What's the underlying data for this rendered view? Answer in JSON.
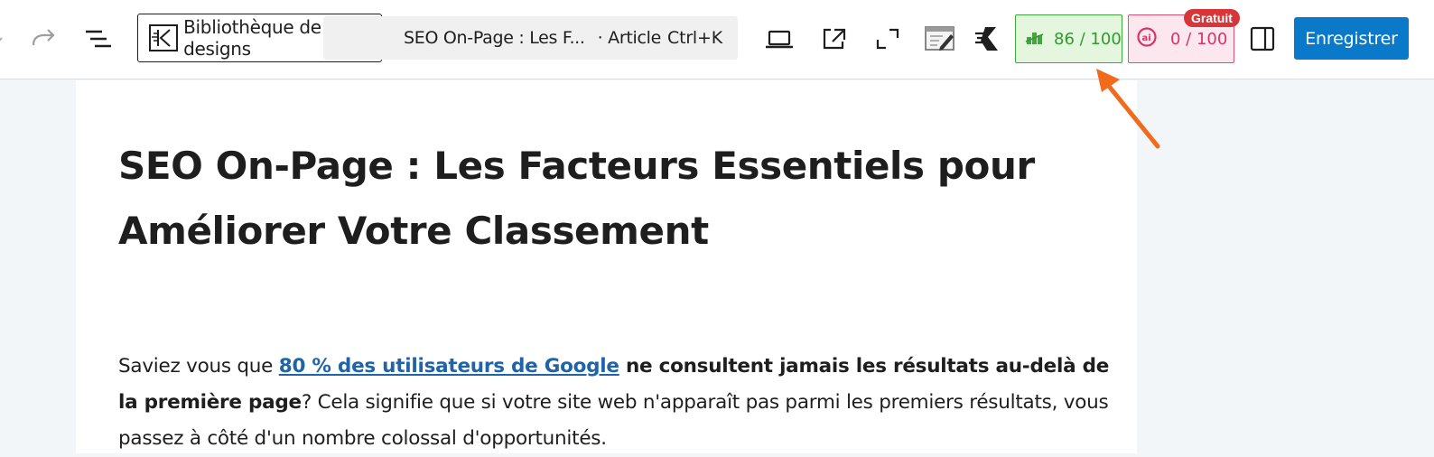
{
  "toolbar": {
    "design_library_label": "Bibliothèque de designs",
    "document": {
      "title": "SEO On-Page : Les F...",
      "type": "· Article",
      "shortcut": "Ctrl+K"
    },
    "seo_score": "86 / 100",
    "ai_score": "0 / 100",
    "ai_badge": "Gratuit",
    "save_label": "Enregistrer"
  },
  "post": {
    "title_line1": "SEO On-Page : Les Facteurs Essentiels pour",
    "title_line2": "Améliorer Votre Classement",
    "para_intro": "Saviez vous que ",
    "para_link": "80 % des utilisateurs de Google",
    "para_bold": " ne consultent jamais les résultats au-delà de la première page",
    "para_rest": "? Cela signifie que si votre site web n'apparaît pas parmi les premiers résultats, vous passez à côté d'un nombre colossal d'opportunités."
  },
  "colors": {
    "seo_green": "#3dab3a",
    "ai_pink": "#e04f7a",
    "save_blue": "#0a79c9",
    "annotation_arrow": "#f26b1d"
  }
}
